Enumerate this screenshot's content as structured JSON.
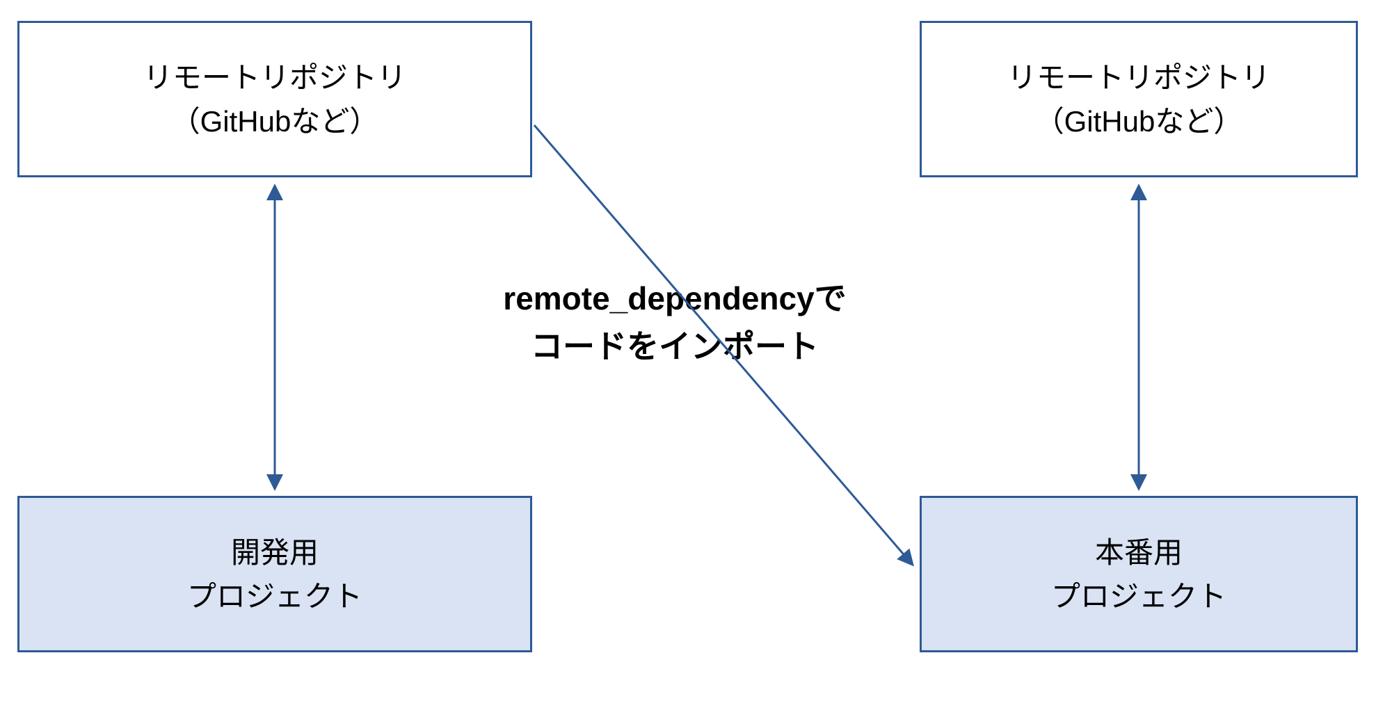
{
  "boxes": {
    "top_left": {
      "line1": "リモートリポジトリ",
      "line2": "（GitHubなど）"
    },
    "top_right": {
      "line1": "リモートリポジトリ",
      "line2": "（GitHubなど）"
    },
    "bottom_left": {
      "line1": "開発用",
      "line2": "プロジェクト"
    },
    "bottom_right": {
      "line1": "本番用",
      "line2": "プロジェクト"
    }
  },
  "center_label": {
    "line1": "remote_dependencyで",
    "line2": "コードをインポート"
  },
  "colors": {
    "border": "#2E5A96",
    "arrow": "#2E5A96",
    "box_blue_fill": "#DAE3F3",
    "box_white_fill": "#ffffff"
  }
}
